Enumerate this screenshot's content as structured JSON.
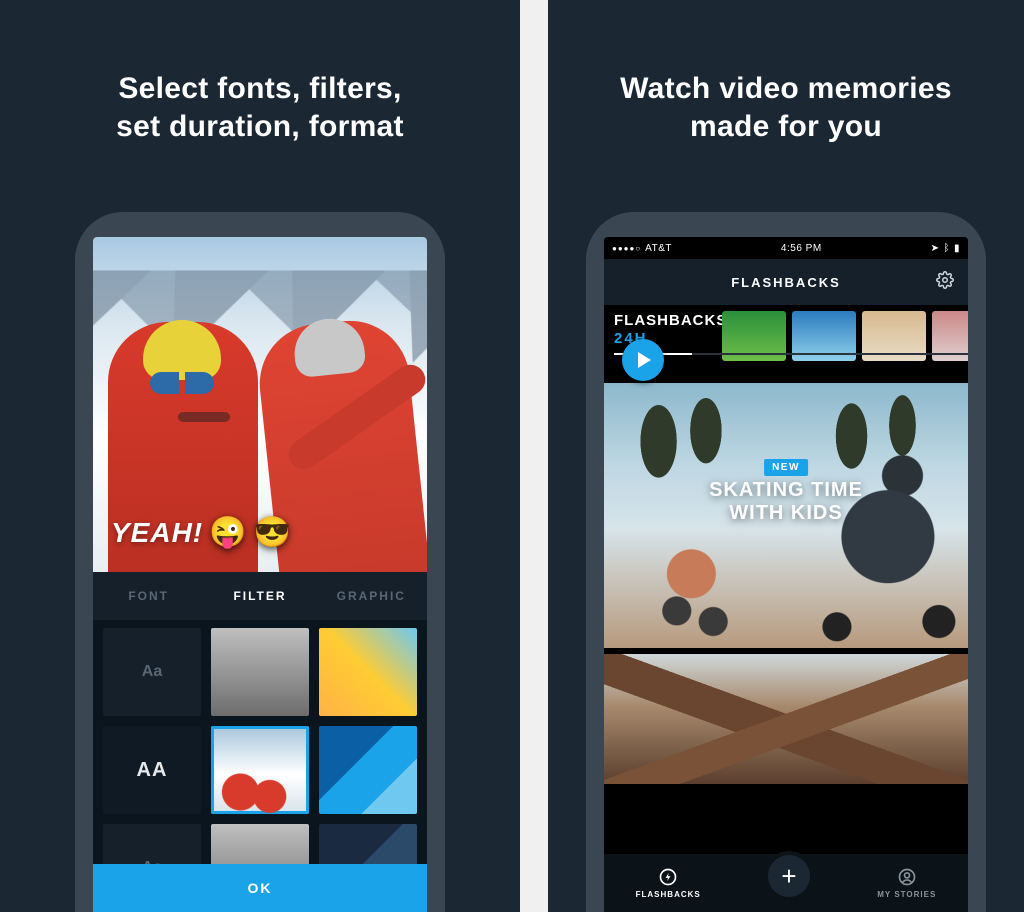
{
  "left": {
    "headline_l1": "Select fonts, filters,",
    "headline_l2": "set duration, format",
    "preview_text": "YEAH!",
    "emoji1": "😜",
    "emoji2": "😎",
    "tabs": {
      "font": "FONT",
      "filter": "FILTER",
      "graphic": "GRAPHIC"
    },
    "thumbs": {
      "aa_dim1": "Aa",
      "aa_big": "AA",
      "aa_dim2": "Aa"
    },
    "ok": "OK"
  },
  "right": {
    "headline_l1": "Watch video memories",
    "headline_l2": "made for you",
    "status": {
      "carrier": "AT&T",
      "time": "4:56 PM"
    },
    "navbar_title": "FLASHBACKS",
    "flash_label": "FLASHBACKS",
    "flash_sub": "24H",
    "badge": "NEW",
    "story_title_l1": "SKATING TIME",
    "story_title_l2": "WITH KIDS",
    "bottom": {
      "flashbacks": "FLASHBACKS",
      "mystories": "MY STORIES",
      "plus": "+"
    }
  }
}
